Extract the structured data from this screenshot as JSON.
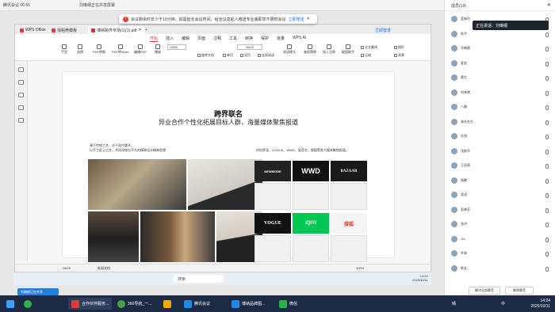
{
  "meetbar": {
    "left": "腾讯会议 06:55",
    "title": "刘琳纲正在共享屏幕"
  },
  "notice": {
    "text": "会议剩余时长少于10分钟，如需延长会议时间，给全议发起人赠送专业版即享不限时会议",
    "link": "立即赠送"
  },
  "wps": {
    "tabs": [
      "WPS Office",
      "找稻壳模板",
      "博纳跨界专场(1)(1).pdf"
    ],
    "right_btn": "立即登录",
    "menu": [
      "开始",
      "插入",
      "编辑",
      "页面",
      "注释",
      "工具",
      "转换",
      "保护",
      "批量",
      "WPS AI"
    ],
    "active_menu": "开始",
    "ribbon_big": [
      "手型",
      "选择",
      "PDF转换",
      "PDF转Word",
      "编辑PDF",
      "播放"
    ],
    "zoom": "100%",
    "page_input": "28/29",
    "ribbon_small": [
      "旋转文档",
      "单页",
      "双页",
      "连续阅读",
      "阅读模式",
      "查找替换",
      "插入注释",
      "截图取字",
      "全文翻译",
      "压缩",
      "图形",
      "背景"
    ],
    "status_left": "28/29",
    "status_mid": "批阅文档",
    "status_zoom": "100%"
  },
  "page": {
    "title": "跨界联名",
    "subtitle": "异业合作个性化拓展目标人群，海量媒体聚焦报道",
    "left_para_1": "源于传统工艺，忠于现代美学，",
    "left_para_2": "以手工匠心之作，共同淬炼出不凡的精致设计精神思想",
    "right_para": "时尚界宠，VOGUE、WWD、爱奇艺、搜狐等各大媒体聚焦报道。",
    "mags": [
      "NEWMODE",
      "WWD",
      "BAZAAR",
      "VOGUE",
      "iQIYI",
      "搜狐"
    ]
  },
  "taskbar_inner": {
    "search": "搜索",
    "time": "14:24",
    "date": "2025/10/11"
  },
  "panel": {
    "title": "成员(19)",
    "speaker": "正在讲话：刘琳纲",
    "members": [
      "蓝新玲",
      "秋平",
      "华琳建",
      "爱女",
      "黄生",
      "刘林艳",
      "八瓣",
      "林先先生",
      "杜锐",
      "沈群华",
      "王田燕",
      "杨鹏",
      "笑语",
      "彭晓芳",
      "张洪",
      "111",
      "齐翠",
      "陈女"
    ],
    "btn_left": "解决全部静音",
    "btn_right": "解除静音"
  },
  "share_label": "刘琳纲正在共享",
  "taskbar": {
    "items": [
      "合作伙伴服务...",
      "360导航_一...",
      "腾讯会议",
      "博纳品牌图...",
      "微信"
    ],
    "weather": "晴",
    "lang": "中",
    "time": "14:24",
    "date": "2025/10/11"
  }
}
